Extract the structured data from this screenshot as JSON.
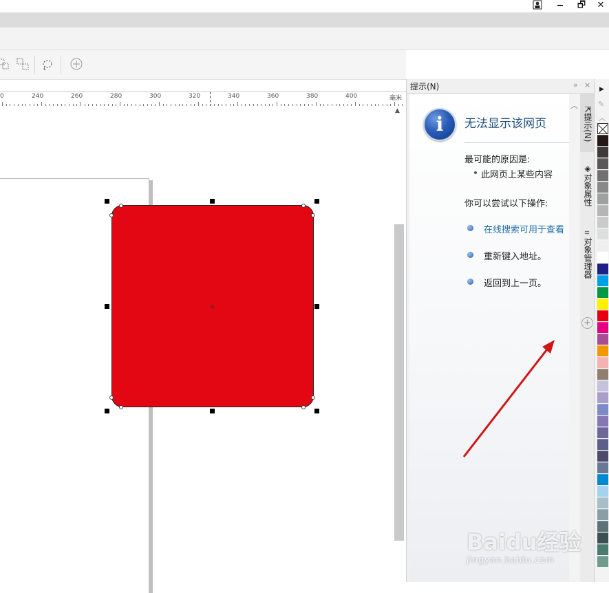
{
  "window": {
    "controls": {
      "restore_icon": "user-icon",
      "minimize": "🗕",
      "maximize": "🗗",
      "close": "✕"
    }
  },
  "toolbar": {
    "icons": [
      "group-icon",
      "ungroup-icon",
      "lasso-icon",
      "add-icon"
    ]
  },
  "ruler": {
    "ticks": [
      "0",
      "240",
      "260",
      "280",
      "300",
      "320",
      "340",
      "360",
      "380",
      "400"
    ],
    "unit": "毫米"
  },
  "docker": {
    "title": "提示(N)",
    "error": {
      "title": "无法显示该网页",
      "cause_heading": "最可能的原因是:",
      "causes": [
        "此网页上某些内容"
      ],
      "try_heading": "你可以尝试以下操作:",
      "actions": [
        {
          "label": "在线搜索可用于查看",
          "link": true
        },
        {
          "label": "重新键入地址。",
          "link": false
        },
        {
          "label": "返回到上一页。",
          "link": false
        }
      ]
    },
    "tabs": [
      "提示(N)",
      "对象属性",
      "对象管理器"
    ]
  },
  "palette": {
    "colors": [
      "#231815",
      "#3e3a39",
      "#595757",
      "#727171",
      "#898989",
      "#9fa0a0",
      "#b5b5b6",
      "#c9caca",
      "#dcdddd",
      "#efefef",
      "#ffffff",
      "#1d2088",
      "#00a0e9",
      "#009944",
      "#fff100",
      "#e60012",
      "#e4007f",
      "#a84c93",
      "#f39800",
      "#f5b2b2",
      "#8f7f71",
      "#c4c2dd",
      "#a99ec9",
      "#7b8bc8",
      "#8477b3",
      "#6f6799",
      "#5b5f8a",
      "#4e4a6b",
      "#697894",
      "#0089cf",
      "#a5d3ef",
      "#a7bdc7",
      "#8a9ea6",
      "#5d7177",
      "#3d5052",
      "#4b7b6e",
      "#6e9b8e"
    ]
  },
  "watermark": {
    "logo": "Baidu经验",
    "sub": "jingyan.baidu.com"
  },
  "colors": {
    "shape_fill": "#e30613",
    "link": "#1f6ea8",
    "annotation_arrow": "#d01717"
  }
}
